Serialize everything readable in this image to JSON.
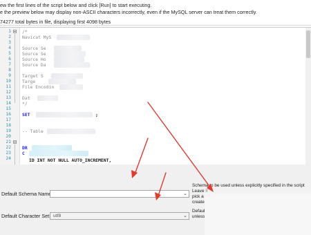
{
  "header": {
    "line1": "ew the first lines of the script below and click [Run] to start executing.",
    "line2": "e the preview below may display non-ASCII characters incorrectly, even if the MySQL server can treat them correctly.",
    "line3": "74277 total bytes in file, displaying first 4098 bytes"
  },
  "editor": {
    "line_numbers": [
      "1",
      "2",
      "3",
      "4",
      "5",
      "6",
      "7",
      "8",
      "9",
      "10",
      "11",
      "12",
      "13",
      "14",
      "15",
      "16",
      "17",
      "18",
      "19",
      "20",
      "21",
      "22",
      "23",
      "24"
    ],
    "code": {
      "l1": "/*",
      "l2": "Navicat MyS",
      "l4": "Source Se",
      "l5": "Source Se",
      "l6": "Source Ho",
      "l7": "Source Da",
      "l9": "Target S",
      "l10": "Targe",
      "l11": "File Encodin",
      "l13": "Dat",
      "l14": "*/",
      "l16_kw": "SET",
      "l16_end": ";",
      "l19": "-- Table",
      "l22_kw": "DR",
      "l23_kw": "C",
      "l24": "ID  INT   NOT NULL AUTO_INCREMENT,"
    }
  },
  "options": {
    "schema_label": "Default Schema Name:",
    "schema_value": "",
    "charset_label": "Default Character Set:",
    "charset_value": "utf8",
    "help_schema_1": "Schema to be used unless explicitly specified in the script",
    "help_schema_2": "Leave it",
    "help_schema_3": "pick a sch",
    "help_schema_4": "create",
    "help_charset_1": "Default",
    "help_charset_2": "unless"
  },
  "colors": {
    "arrow": "#e23a2e",
    "line_number": "#2b91af",
    "keyword": "#1a1aff"
  }
}
